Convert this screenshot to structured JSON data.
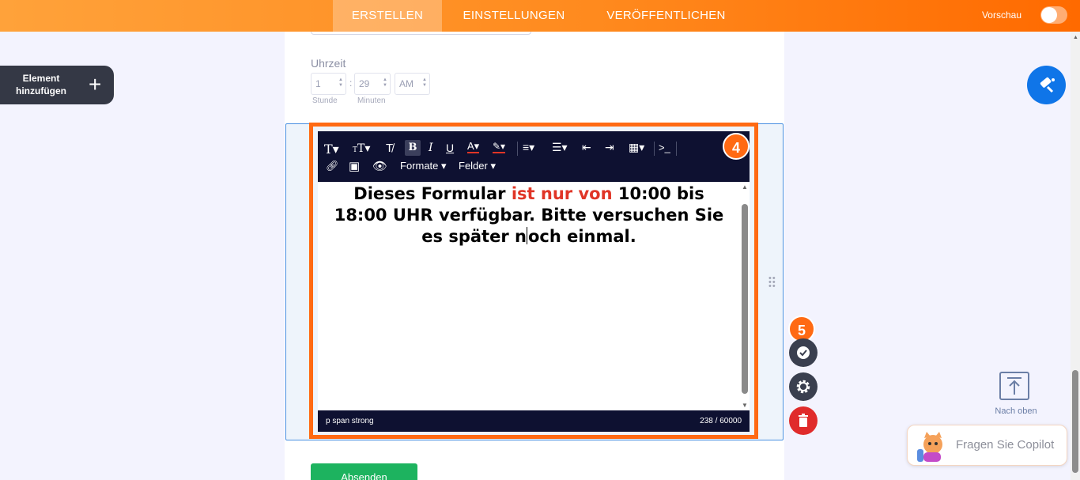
{
  "topbar": {
    "tabs": [
      {
        "label": "ERSTELLEN",
        "active": true
      },
      {
        "label": "EINSTELLUNGEN",
        "active": false
      },
      {
        "label": "VERÖFFENTLICHEN",
        "active": false
      }
    ],
    "preview_label": "Vorschau",
    "preview_on": false
  },
  "sidebar": {
    "add_element_label": "Element hinzufügen",
    "add_icon": "plus-icon"
  },
  "form": {
    "time_label": "Uhrzeit",
    "hour_value": "1",
    "minute_value": "29",
    "ampm_value": "AM",
    "hour_sublabel": "Stunde",
    "minute_sublabel": "Minuten",
    "colon": ":",
    "submit_label": "Absenden"
  },
  "editor": {
    "formats_label": "Formate",
    "fields_label": "Felder",
    "text_part1": "Dieses Formular ",
    "text_red": "ist nur von",
    "text_part2": " 10:00 bis 18:00 UHR verfügbar. Bitte versuchen Sie es später n",
    "text_part3": "och einmal.",
    "path": "p  span  strong",
    "char_count": "238 / 60000",
    "accent_red": "#e03526"
  },
  "badges": {
    "editor_step": "4",
    "actions_step": "5"
  },
  "right": {
    "back_to_top_label": "Nach oben",
    "copilot_label": "Fragen Sie Copilot"
  },
  "colors": {
    "brand_orange": "#ff7a10",
    "highlight": "#ff6a13",
    "toolbar_bg": "#0e1131",
    "theme_blue": "#0f75e8",
    "submit_green": "#1db35f",
    "delete_red": "#e02b2b"
  }
}
